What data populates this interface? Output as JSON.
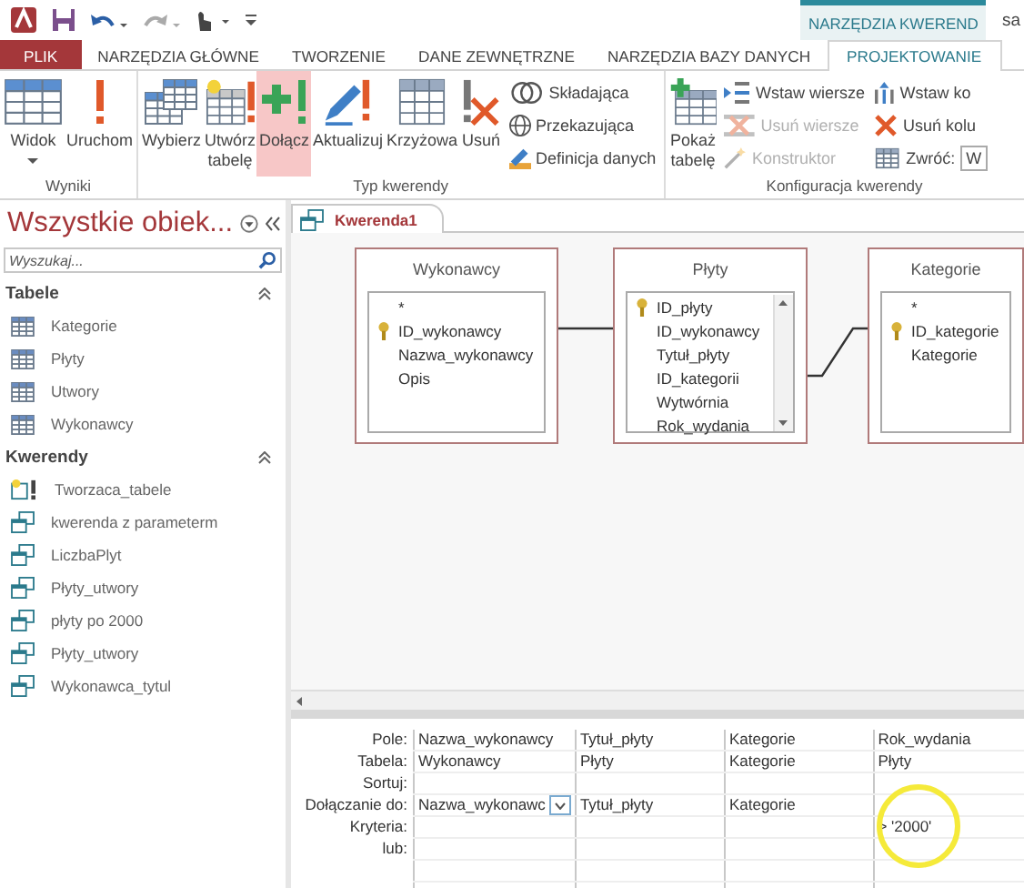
{
  "title_bar": {
    "context_group": "NARZĘDZIA KWEREND",
    "title_fragment": "sa"
  },
  "tabs": [
    {
      "label": "PLIK",
      "kind": "file",
      "selected": false
    },
    {
      "label": "NARZĘDZIA GŁÓWNE",
      "kind": "tab",
      "selected": false
    },
    {
      "label": "TWORZENIE",
      "kind": "tab",
      "selected": false
    },
    {
      "label": "DANE ZEWNĘTRZNE",
      "kind": "tab",
      "selected": false
    },
    {
      "label": "NARZĘDZIA BAZY DANYCH",
      "kind": "tab",
      "selected": false
    },
    {
      "label": "PROJEKTOWANIE",
      "kind": "tab",
      "selected": true
    }
  ],
  "ribbon": {
    "groups": [
      {
        "label": "Wyniki",
        "items": [
          {
            "kind": "large",
            "label": "Widok",
            "dropdown": true,
            "selected": false
          },
          {
            "kind": "large",
            "label": "Uruchom",
            "dropdown": false,
            "selected": false
          }
        ]
      },
      {
        "label": "Typ kwerendy",
        "items": [
          {
            "kind": "large",
            "label": "Wybierz",
            "dropdown": false,
            "selected": false
          },
          {
            "kind": "large",
            "label": "Utwórz tabelę",
            "dropdown": false,
            "selected": false
          },
          {
            "kind": "large",
            "label": "Dołącz",
            "dropdown": false,
            "selected": true
          },
          {
            "kind": "large",
            "label": "Aktualizuj",
            "dropdown": false,
            "selected": false
          },
          {
            "kind": "large",
            "label": "Krzyżowa",
            "dropdown": false,
            "selected": false
          },
          {
            "kind": "large",
            "label": "Usuń",
            "dropdown": false,
            "selected": false
          },
          {
            "kind": "stack",
            "items": [
              {
                "kind": "button",
                "label": "Składająca"
              },
              {
                "kind": "button",
                "label": "Przekazująca"
              },
              {
                "kind": "button",
                "label": "Definicja danych"
              }
            ]
          }
        ]
      },
      {
        "label": "Konfiguracja kwerendy",
        "items": [
          {
            "kind": "large",
            "label": "Pokaż tabelę",
            "dropdown": false,
            "selected": false
          },
          {
            "kind": "stack",
            "items": [
              {
                "kind": "button",
                "label": "Wstaw wiersze",
                "disabled": false
              },
              {
                "kind": "button",
                "label": "Usuń wiersze",
                "disabled": true
              },
              {
                "kind": "button",
                "label": "Konstruktor",
                "disabled": true
              }
            ]
          },
          {
            "kind": "stack",
            "items": [
              {
                "kind": "button",
                "label": "Wstaw ko"
              },
              {
                "kind": "button",
                "label": "Usuń kolu"
              },
              {
                "kind": "field",
                "label": "Zwróć:",
                "value": "W"
              }
            ]
          }
        ]
      }
    ]
  },
  "navigation": {
    "title": "Wszystkie obiek...",
    "search": {
      "placeholder": "Wyszukaj..."
    },
    "groups": [
      {
        "label": "Tabele",
        "items": [
          {
            "label": "Kategorie",
            "kind": "table"
          },
          {
            "label": "Płyty",
            "kind": "table"
          },
          {
            "label": "Utwory",
            "kind": "table"
          },
          {
            "label": "Wykonawcy",
            "kind": "table"
          }
        ]
      },
      {
        "label": "Kwerendy",
        "items": [
          {
            "label": "Tworzaca_tabele",
            "kind": "make_table"
          },
          {
            "label": "kwerenda z parameterm",
            "kind": "query"
          },
          {
            "label": "LiczbaPlyt",
            "kind": "query"
          },
          {
            "label": "Płyty_utwory",
            "kind": "query"
          },
          {
            "label": "płyty po 2000",
            "kind": "query"
          },
          {
            "label": "Płyty_utwory",
            "kind": "query"
          },
          {
            "label": "Wykonawca_tytul",
            "kind": "query"
          }
        ]
      }
    ]
  },
  "document_tab": {
    "title": "Kwerenda1"
  },
  "query_tables": [
    {
      "title": "Wykonawcy",
      "scrollbar": false,
      "fields": [
        {
          "name": "*",
          "key": false
        },
        {
          "name": "ID_wykonawcy",
          "key": true
        },
        {
          "name": "Nazwa_wykonawcy",
          "key": false
        },
        {
          "name": "Opis",
          "key": false
        }
      ]
    },
    {
      "title": "Płyty",
      "scrollbar": true,
      "fields": [
        {
          "name": "ID_płyty",
          "key": true
        },
        {
          "name": "ID_wykonawcy",
          "key": false
        },
        {
          "name": "Tytuł_płyty",
          "key": false
        },
        {
          "name": "ID_kategorii",
          "key": false
        },
        {
          "name": "Wytwórnia",
          "key": false
        },
        {
          "name": "Rok_wydania",
          "key": false
        }
      ]
    },
    {
      "title": "Kategorie",
      "scrollbar": false,
      "fields": [
        {
          "name": "*",
          "key": false
        },
        {
          "name": "ID_kategorie",
          "key": true
        },
        {
          "name": "Kategorie",
          "key": false
        }
      ]
    }
  ],
  "query_grid": {
    "row_labels": [
      "Pole:",
      "Tabela:",
      "Sortuj:",
      "Dołączanie do:",
      "Kryteria:",
      "lub:"
    ],
    "columns": [
      {
        "field": "Nazwa_wykonawcy",
        "table": "Wykonawcy",
        "append_to": "Nazwa_wykonawc",
        "dropdown": true
      },
      {
        "field": "Tytuł_płyty",
        "table": "Płyty",
        "append_to": "Tytuł_płyty",
        "dropdown": false
      },
      {
        "field": "Kategorie",
        "table": "Kategorie",
        "append_to": "Kategorie",
        "dropdown": false
      },
      {
        "field": "Rok_wydania",
        "table": "Płyty",
        "criteria": "> '2000'",
        "dropdown": false
      }
    ]
  }
}
